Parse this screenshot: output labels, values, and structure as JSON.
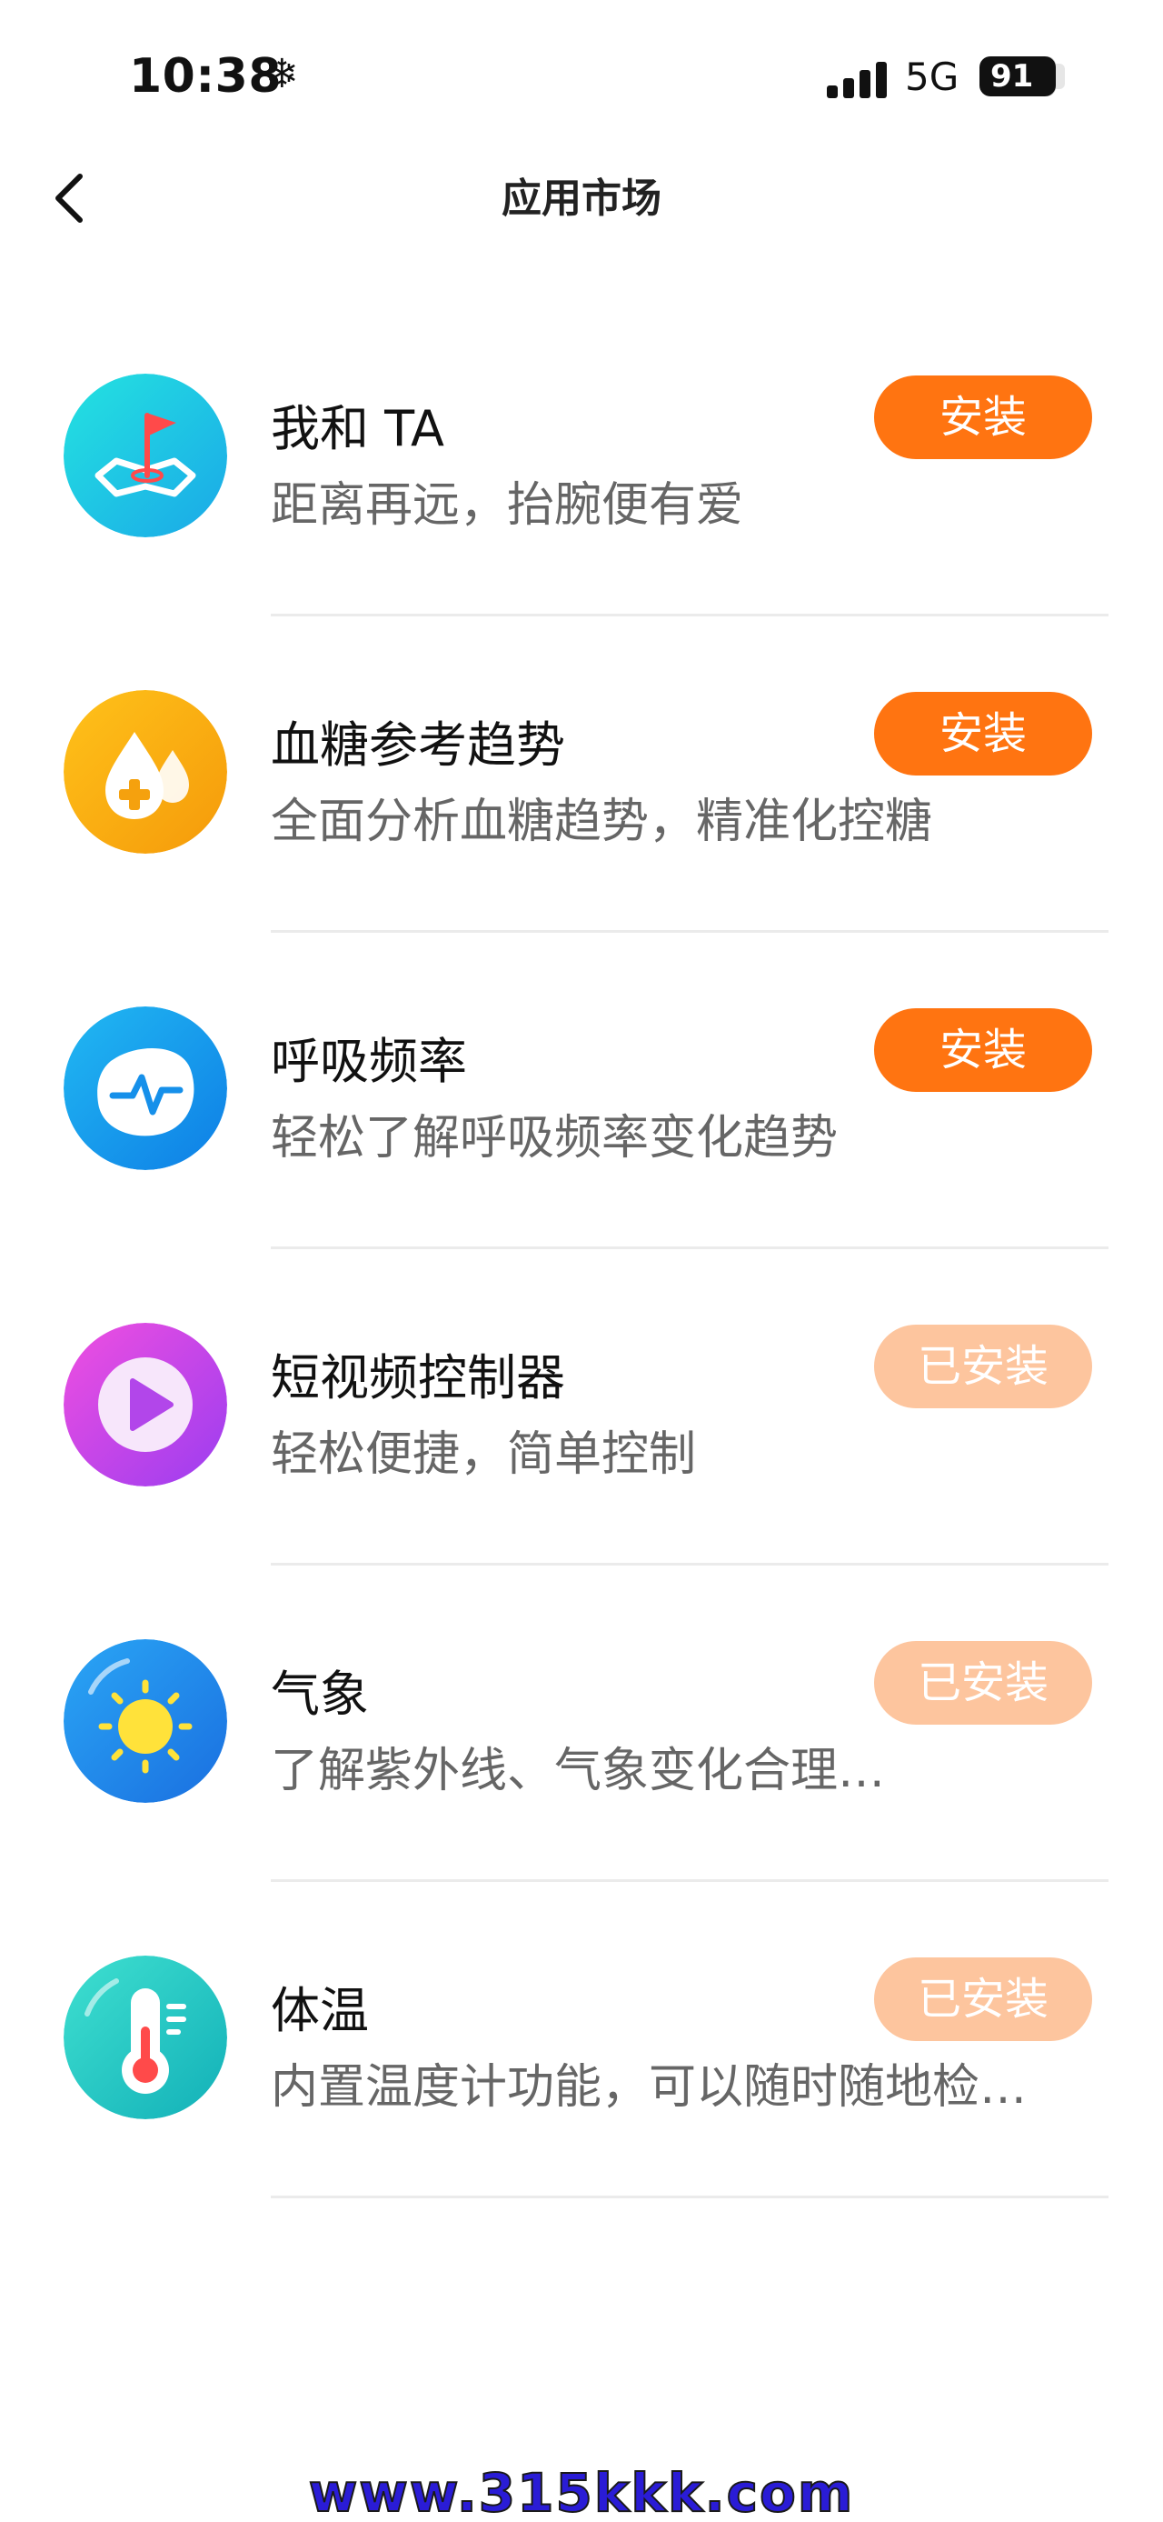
{
  "status_bar": {
    "time": "10:38",
    "network": "5G",
    "battery": "91"
  },
  "nav": {
    "title": "应用市场"
  },
  "apps": [
    {
      "name": "我和 TA",
      "desc": "距离再远，抬腕便有爱",
      "button": "安装",
      "icon": "map-flag-icon",
      "installed": false
    },
    {
      "name": "血糖参考趋势",
      "desc": "全面分析血糖趋势，精准化控糖",
      "button": "安装",
      "icon": "blood-drop-icon",
      "installed": false
    },
    {
      "name": "呼吸频率",
      "desc": "轻松了解呼吸频率变化趋势",
      "button": "安装",
      "icon": "breath-wave-icon",
      "installed": false
    },
    {
      "name": "短视频控制器",
      "desc": "轻松便捷，简单控制",
      "button": "已安装",
      "icon": "play-icon",
      "installed": true
    },
    {
      "name": "气象",
      "desc": "了解紫外线、气象变化合理…",
      "button": "已安装",
      "icon": "sun-icon",
      "installed": true
    },
    {
      "name": "体温",
      "desc": "内置温度计功能，可以随时随地检…",
      "button": "已安装",
      "icon": "thermometer-icon",
      "installed": true
    }
  ],
  "colors": {
    "install": "#ff7411",
    "installed": "#fdc59e"
  },
  "watermark": "www.315kkk.com"
}
